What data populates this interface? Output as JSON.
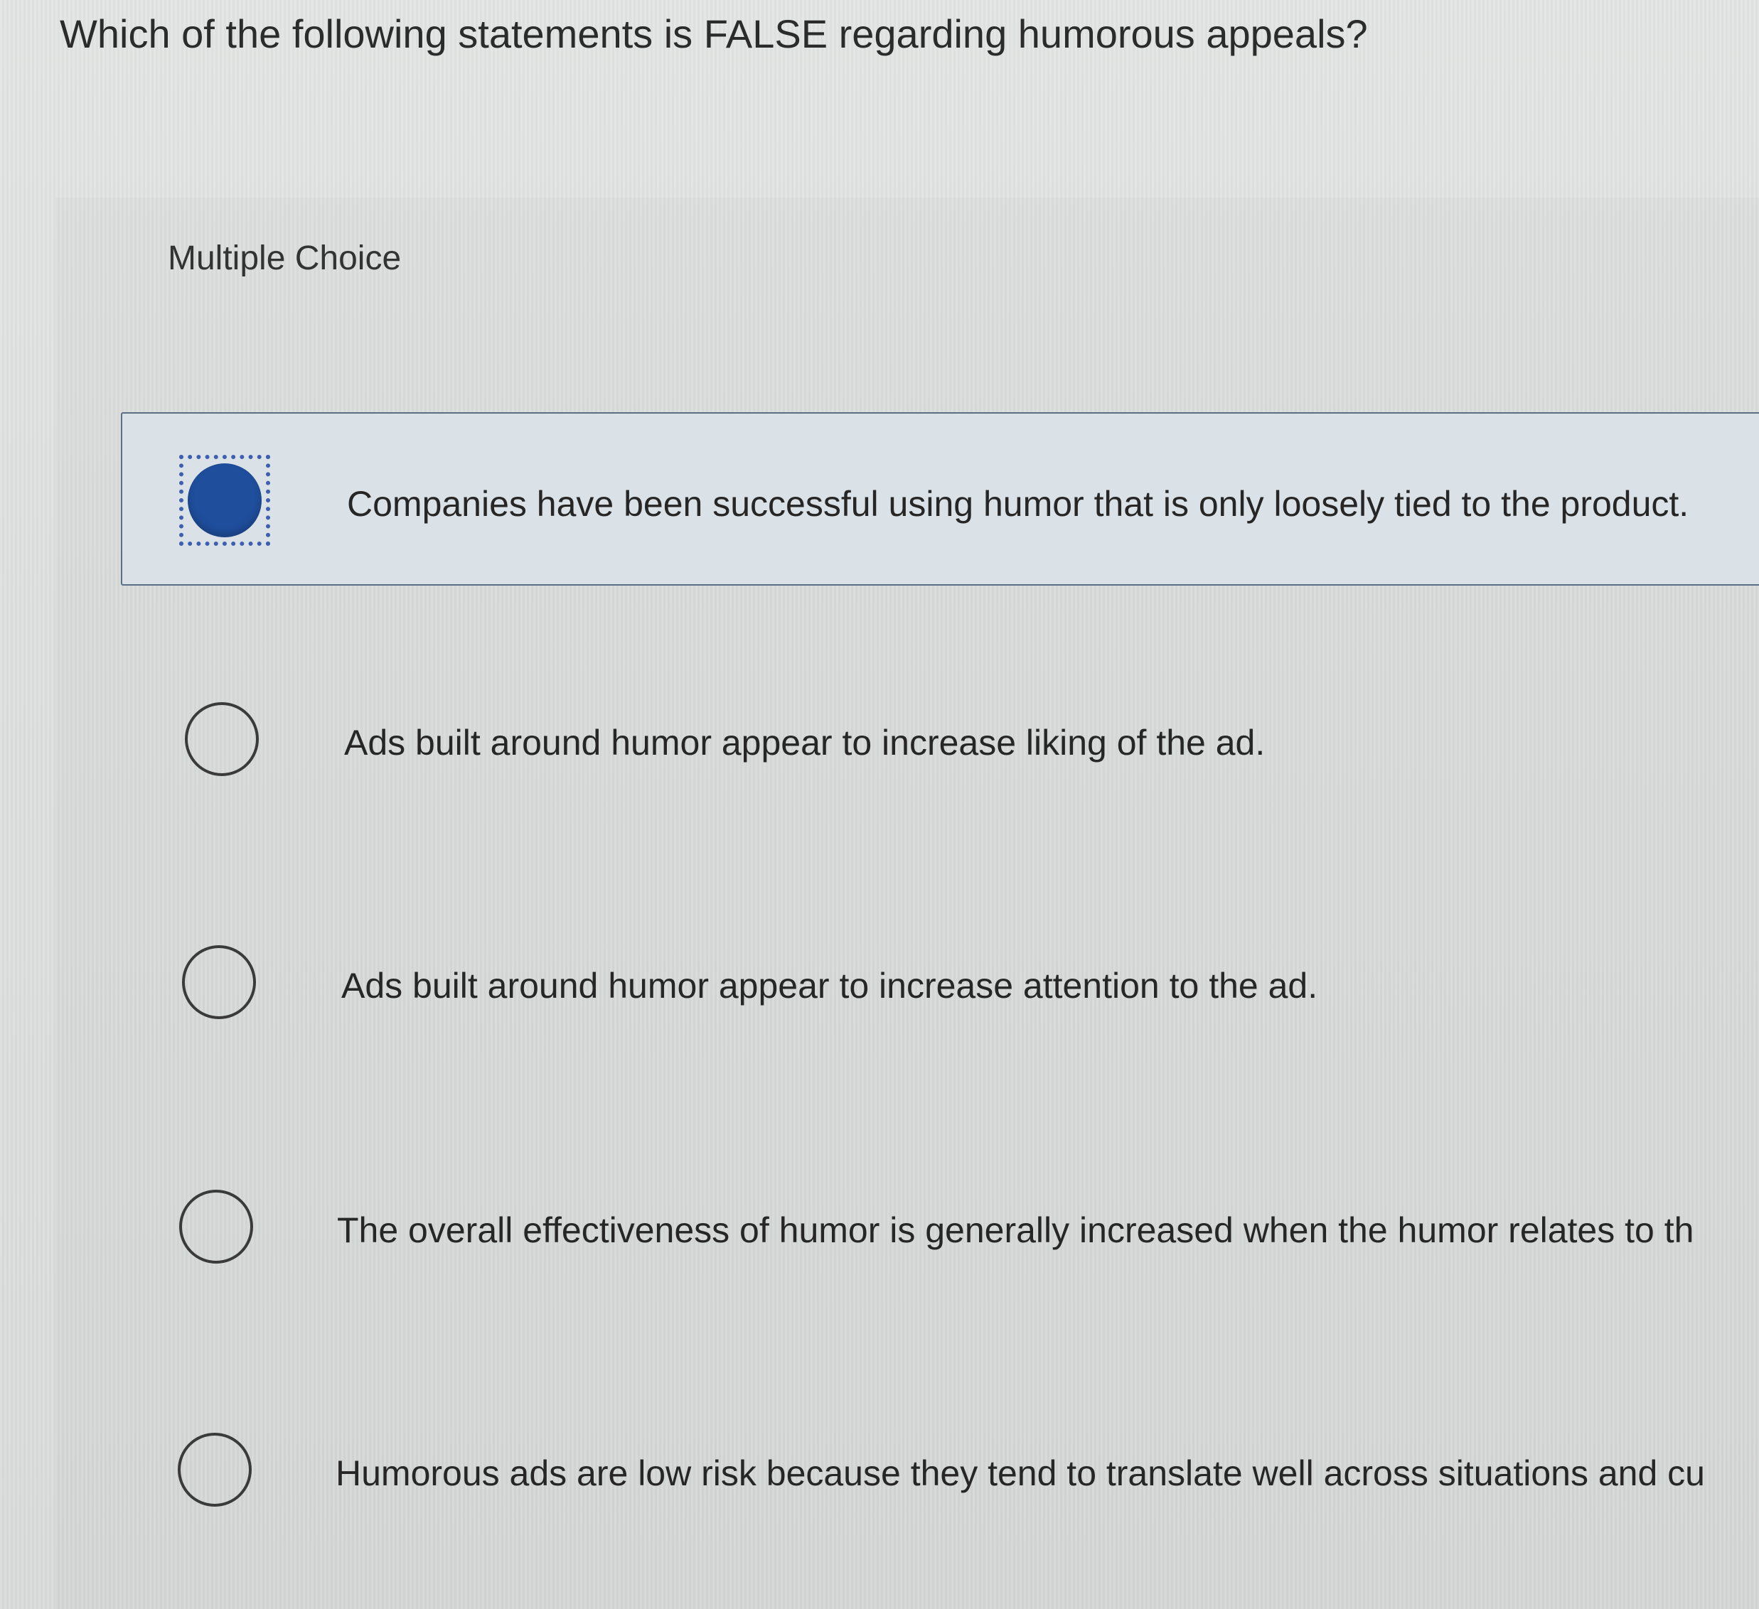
{
  "question": {
    "text": "Which of the following statements is FALSE regarding humorous appeals?"
  },
  "question_type": "Multiple Choice",
  "options": [
    {
      "text": "Companies have been successful using humor that is only loosely tied to the product.",
      "selected": true
    },
    {
      "text": "Ads built around humor appear to increase liking of the ad.",
      "selected": false
    },
    {
      "text": "Ads built around humor appear to increase attention to the ad.",
      "selected": false
    },
    {
      "text": "The overall effectiveness of humor is generally increased when the humor relates to th",
      "selected": false
    },
    {
      "text": "Humorous ads are low risk because they tend to translate well across situations and cu",
      "selected": false
    }
  ],
  "colors": {
    "selected_radio": "#1f4e9c",
    "selected_background": "#dbe2e7",
    "selected_border": "#5a6f86",
    "focus_ring": "#3e5fb0"
  }
}
